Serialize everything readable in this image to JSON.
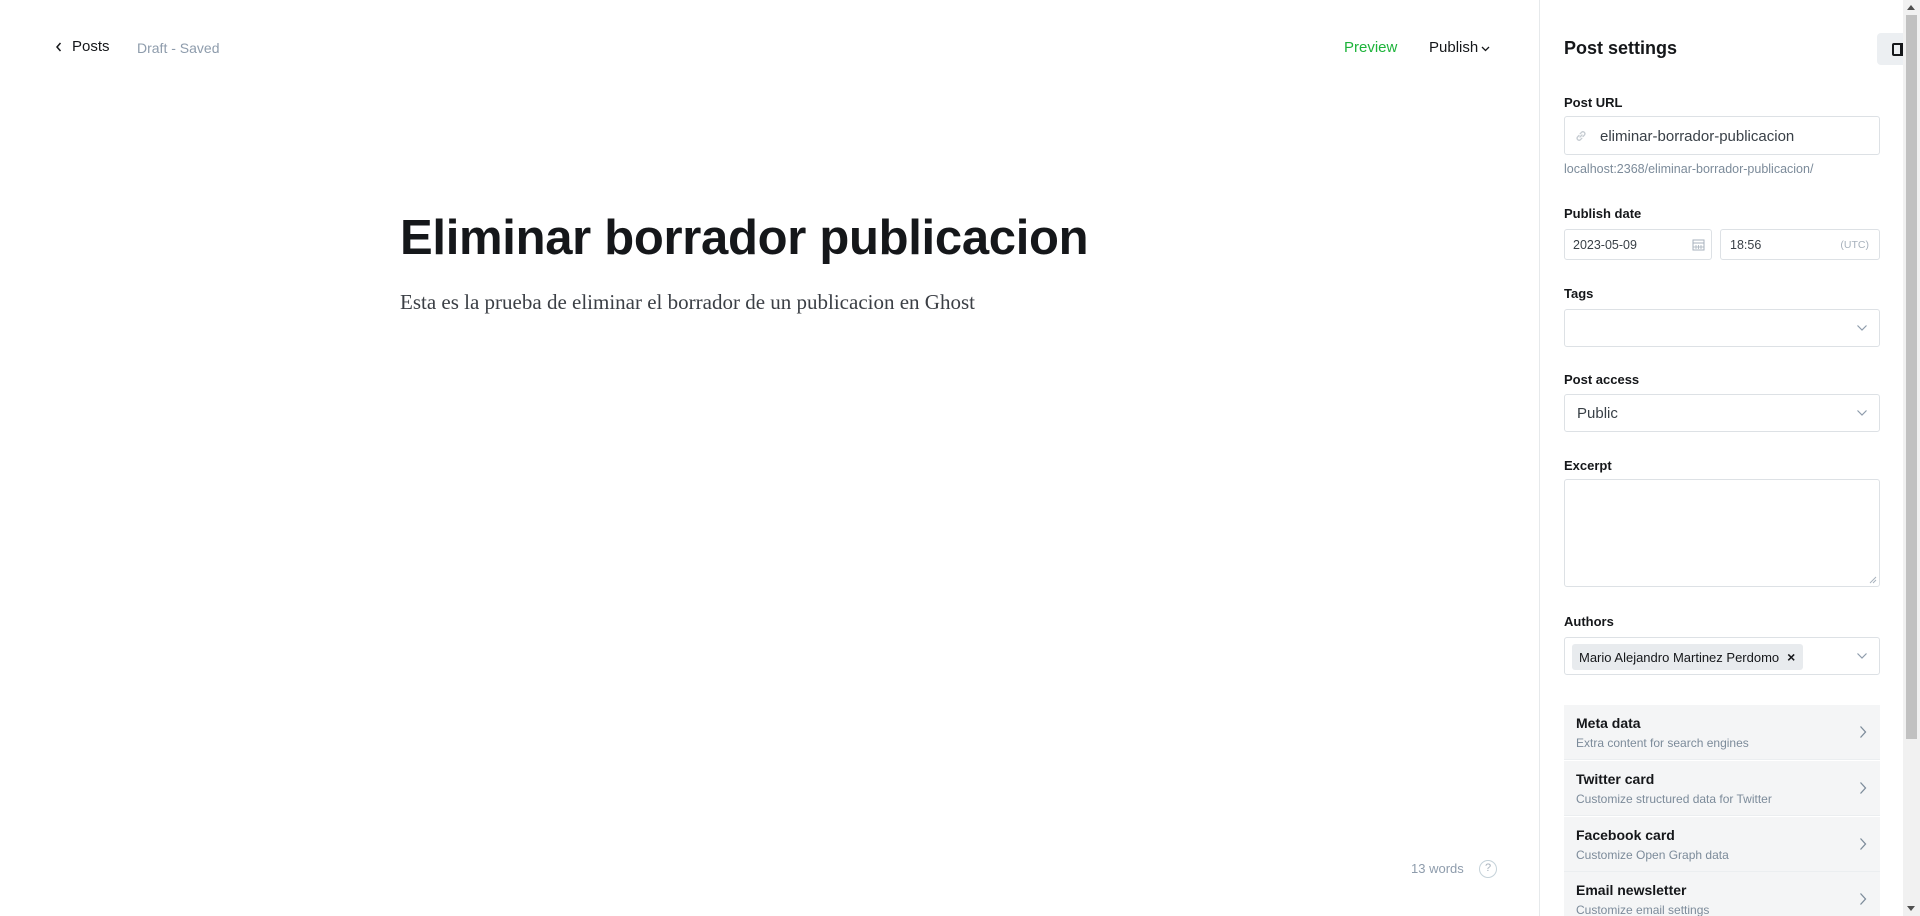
{
  "header": {
    "back_label": "Posts",
    "status": "Draft - Saved",
    "preview_label": "Preview",
    "publish_label": "Publish"
  },
  "post": {
    "title": "Eliminar borrador publicacion",
    "body": "Esta es la prueba de eliminar el borrador de un publicacion en Ghost"
  },
  "footer": {
    "word_count": "13 words",
    "help_glyph": "?"
  },
  "settings": {
    "title": "Post settings",
    "url_label": "Post URL",
    "url_value": "eliminar-borrador-publicacion",
    "url_hint": "localhost:2368/eliminar-borrador-publicacion/",
    "publish_date_label": "Publish date",
    "date_value": "2023-05-09",
    "time_value": "18:56",
    "timezone": "(UTC)",
    "tags_label": "Tags",
    "tags_value": "",
    "access_label": "Post access",
    "access_value": "Public",
    "excerpt_label": "Excerpt",
    "excerpt_value": "",
    "authors_label": "Authors",
    "author_name": "Mario Alejandro Martinez Perdomo",
    "author_remove": "×",
    "sections": [
      {
        "title": "Meta data",
        "subtitle": "Extra content for search engines"
      },
      {
        "title": "Twitter card",
        "subtitle": "Customize structured data for Twitter"
      },
      {
        "title": "Facebook card",
        "subtitle": "Customize Open Graph data"
      },
      {
        "title": "Email newsletter",
        "subtitle": "Customize email settings"
      }
    ]
  },
  "colors": {
    "preview": "#1db33a",
    "muted": "#8e9cac",
    "accordion_bg": "#f4f5f6"
  },
  "icons": [
    "chevron-left-icon",
    "chevron-down-icon",
    "link-icon",
    "calendar-icon",
    "help-icon",
    "sidebar-toggle-icon",
    "chevron-right-icon",
    "close-icon"
  ]
}
